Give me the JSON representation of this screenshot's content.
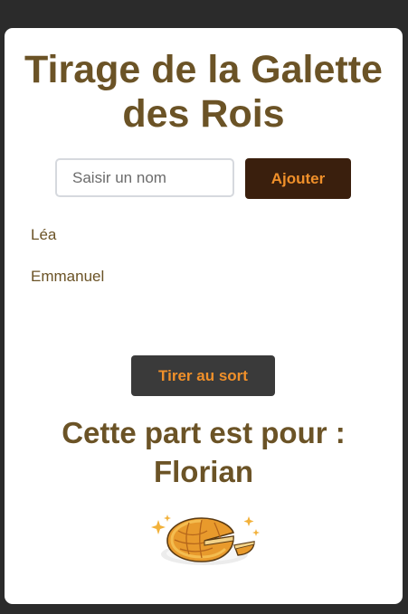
{
  "title": "Tirage de la Galette des Rois",
  "form": {
    "input_placeholder": "Saisir un nom",
    "input_value": "",
    "add_label": "Ajouter"
  },
  "participants": [
    "Léa",
    "Emmanuel"
  ],
  "draw_label": "Tirer au sort",
  "result": {
    "prefix": "Cette part est pour :",
    "winner": "Florian"
  },
  "image": {
    "icon": "galette-icon"
  },
  "colors": {
    "page_background": "#2b2b2b",
    "card_background": "#ffffff",
    "title_text": "#6b5326",
    "add_button_background": "#3a1f0d",
    "draw_button_background": "#3a3a3a",
    "button_text": "#f0902a"
  }
}
